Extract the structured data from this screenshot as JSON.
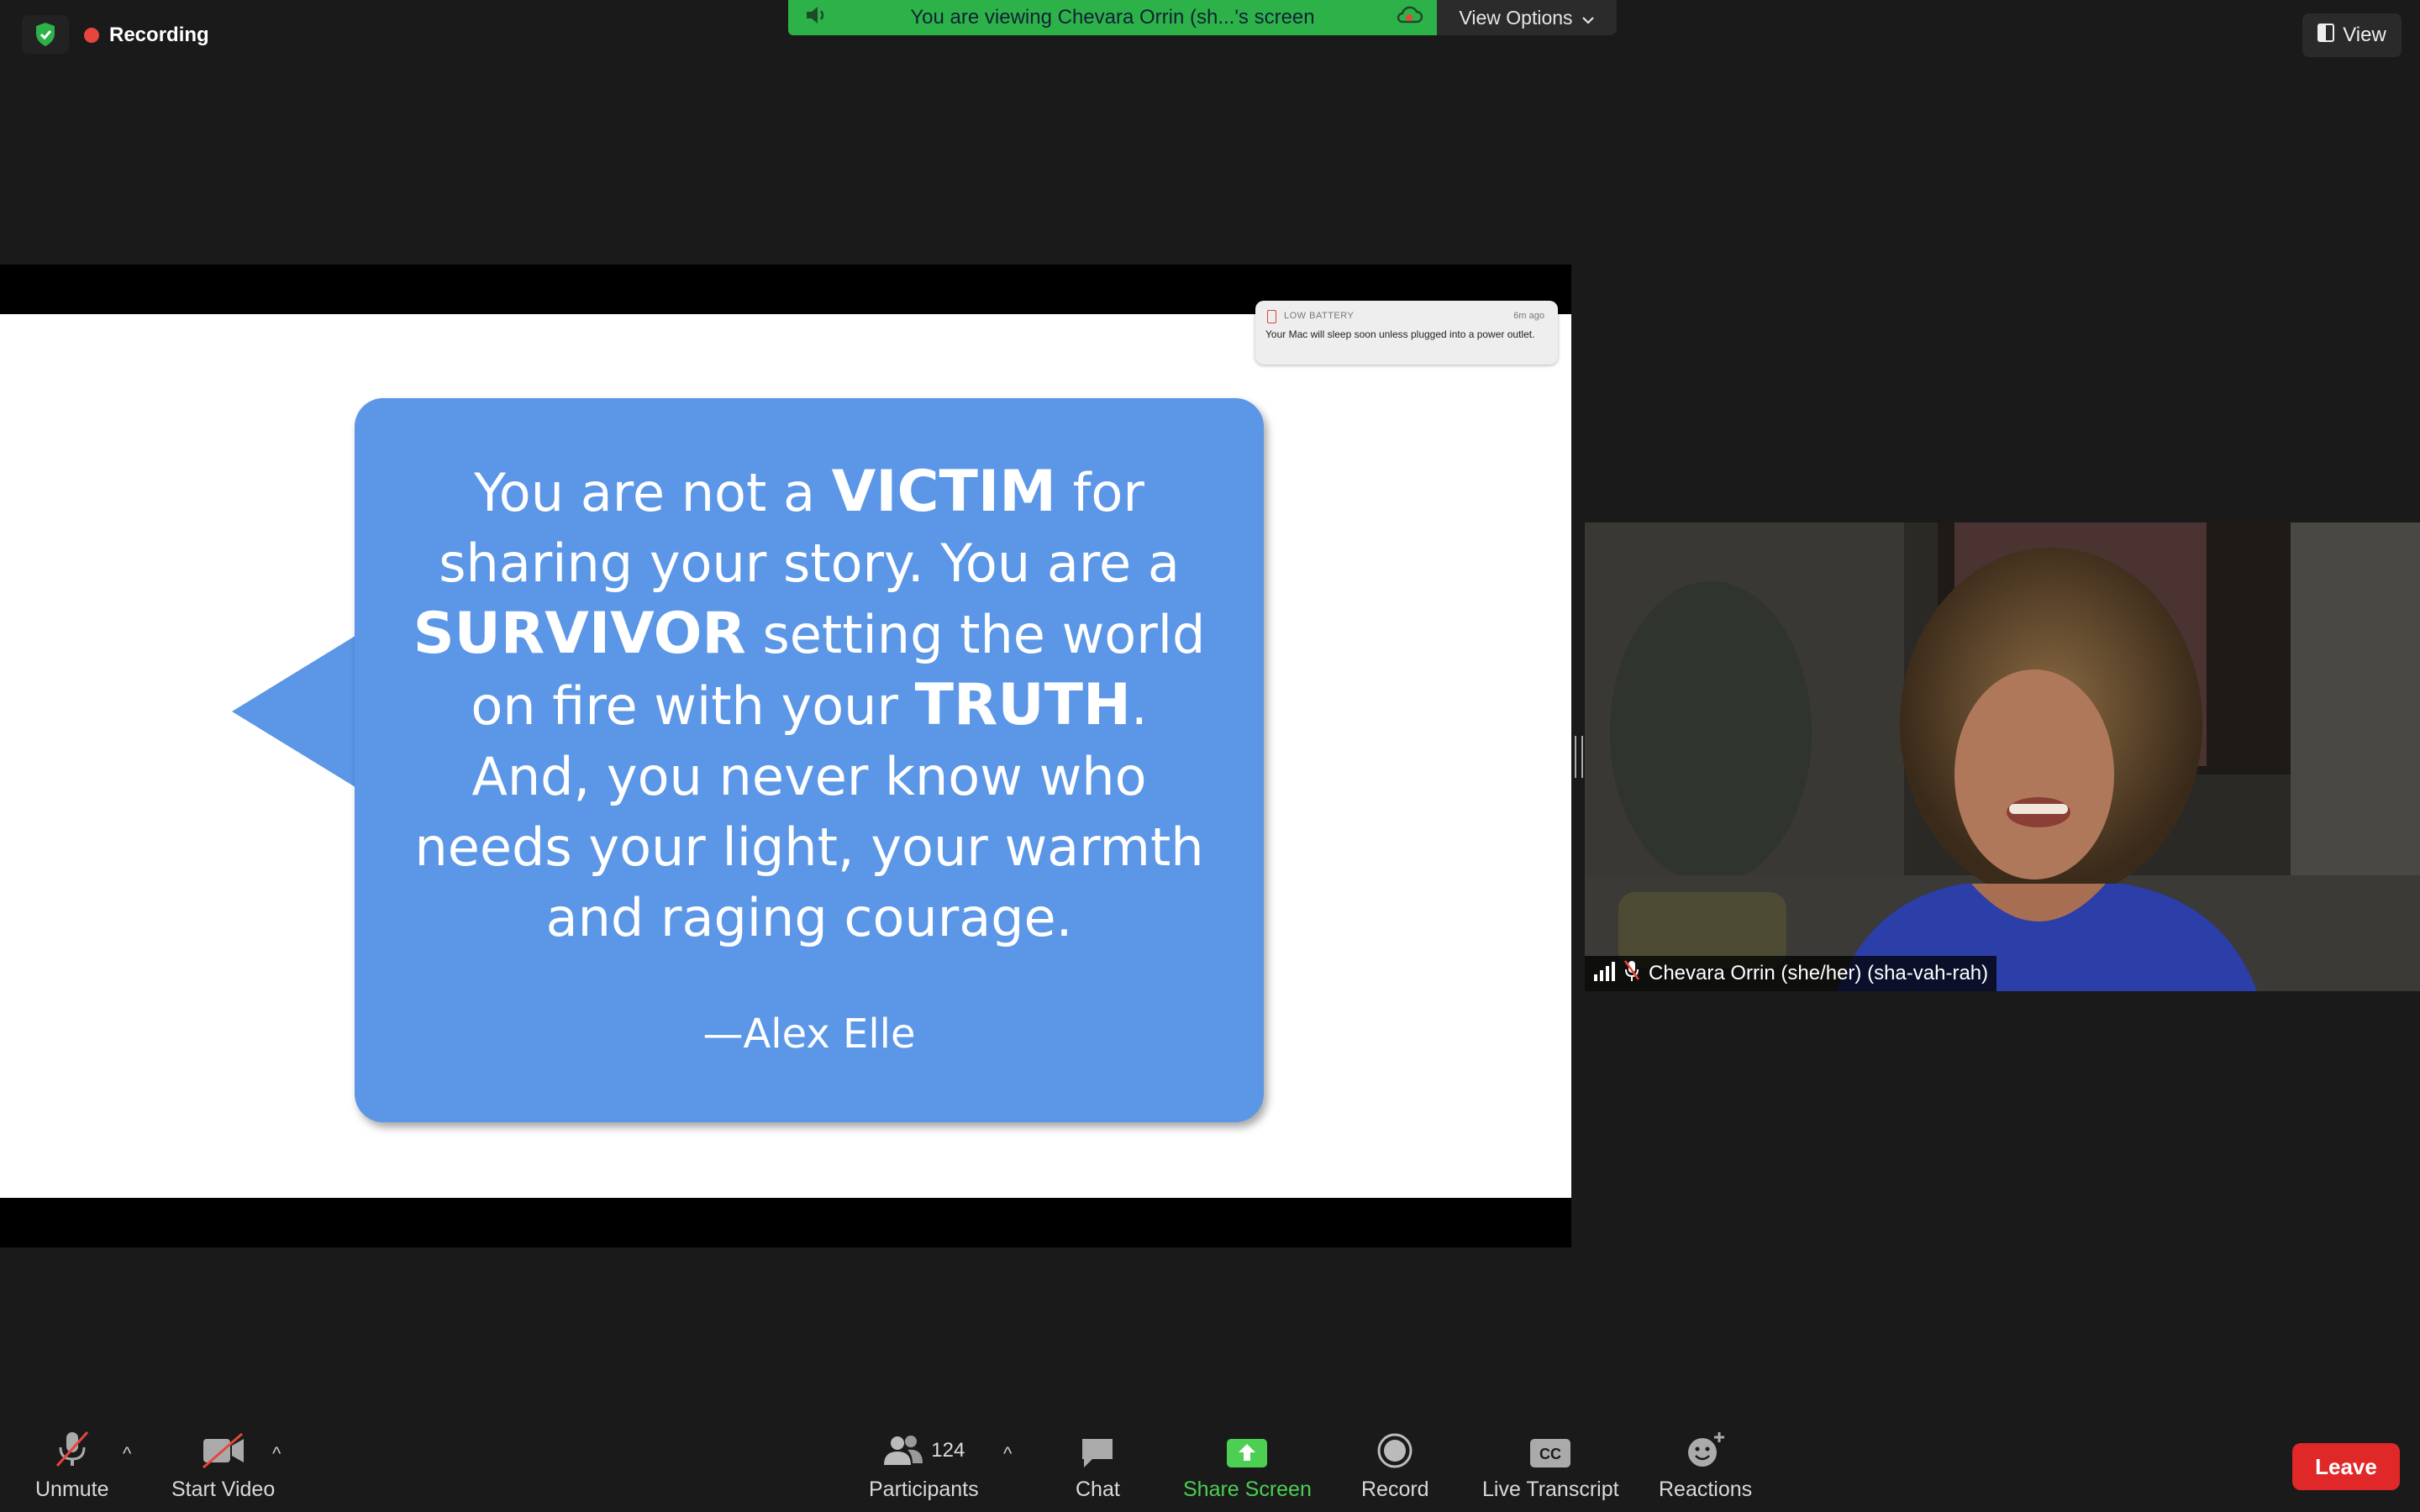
{
  "top": {
    "recording_label": "Recording",
    "banner_text": "You are viewing Chevara Orrin (sh...'s screen",
    "view_options_label": "View Options",
    "view_label": "View"
  },
  "slide": {
    "quote_parts": [
      "You are not a ",
      "VICTIM",
      " for sharing your story. You are a ",
      "SURVIVOR",
      " setting the world on fire with your ",
      "TRUTH",
      ". And, you never know who needs your light, your warmth and raging courage."
    ],
    "author": "—Alex Elle"
  },
  "notification": {
    "app": "LOW BATTERY",
    "time": "6m ago",
    "message": "Your Mac will sleep soon unless plugged into a power outlet."
  },
  "participant": {
    "name": "Chevara Orrin (she/her) (sha-vah-rah)"
  },
  "toolbar": {
    "unmute": "Unmute",
    "start_video": "Start Video",
    "participants": "Participants",
    "participants_count": "124",
    "chat": "Chat",
    "share_screen": "Share Screen",
    "record": "Record",
    "live_transcript": "Live Transcript",
    "reactions": "Reactions",
    "leave": "Leave"
  },
  "colors": {
    "banner_green": "#2db24a",
    "bubble_blue": "#5b97e6",
    "leave_red": "#e02828",
    "share_green": "#4ccf52"
  }
}
